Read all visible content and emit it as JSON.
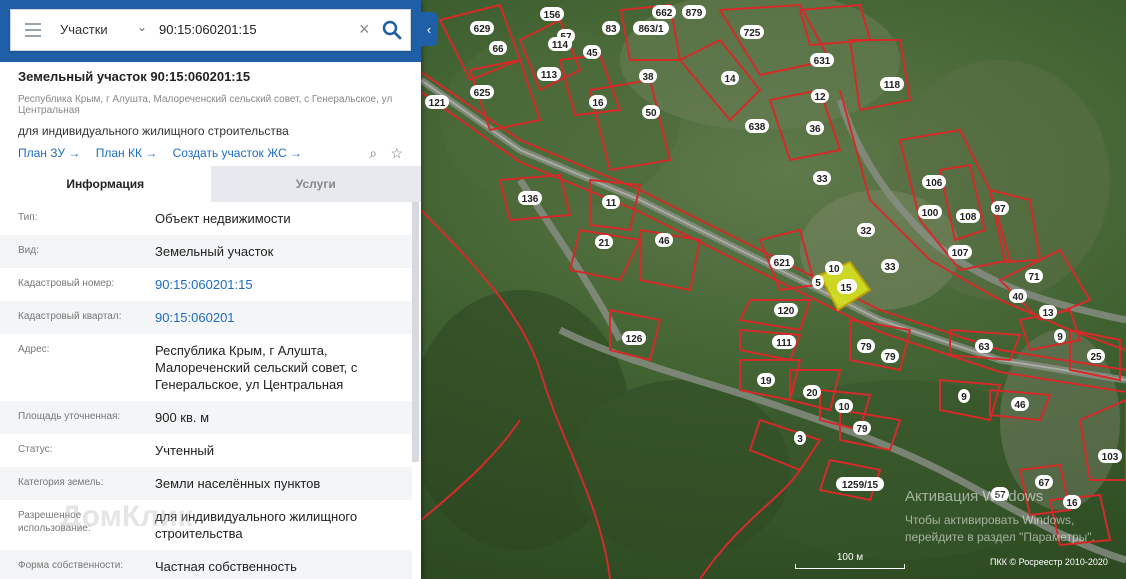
{
  "search": {
    "type_label": "Участки",
    "value": "90:15:060201:15"
  },
  "header": {
    "title": "Земельный участок 90:15:060201:15",
    "address": "Республика Крым, г Алушта, Малореченский сельский совет, с Генеральское, ул Центральная",
    "purpose": "для индивидуального жилищного строительства",
    "links": [
      "План ЗУ →",
      "План КК →",
      "Создать участок ЖС →"
    ]
  },
  "tabs": [
    "Информация",
    "Услуги"
  ],
  "info": [
    {
      "k": "Тип:",
      "v": "Объект недвижимости"
    },
    {
      "k": "Вид:",
      "v": "Земельный участок"
    },
    {
      "k": "Кадастровый номер:",
      "v": "90:15:060201:15"
    },
    {
      "k": "Кадастровый квартал:",
      "v": "90:15:060201"
    },
    {
      "k": "Адрес:",
      "v": "Республика Крым, г Алушта, Малореченский сельский совет, с Генеральское, ул Центральная"
    },
    {
      "k": "Площадь уточненная:",
      "v": "900 кв. м"
    },
    {
      "k": "Статус:",
      "v": "Учтенный"
    },
    {
      "k": "Категория земель:",
      "v": "Земли населённых пунктов"
    },
    {
      "k": "Разрешенное использование:",
      "v": "для индивидуального жилищного строительства"
    },
    {
      "k": "Форма собственности:",
      "v": "Частная собственность"
    }
  ],
  "watermark": "ДомКлик",
  "map": {
    "lot_labels": [
      "629",
      "66",
      "156",
      "879",
      "83",
      "57",
      "863/1",
      "662",
      "114",
      "45",
      "725",
      "631",
      "113",
      "38",
      "14",
      "118",
      "121",
      "625",
      "16",
      "12",
      "638",
      "36",
      "50",
      "33",
      "136",
      "11",
      "106",
      "100",
      "108",
      "97",
      "21",
      "46",
      "32",
      "107",
      "621",
      "10",
      "5",
      "15",
      "33",
      "71",
      "40",
      "120",
      "13",
      "126",
      "111",
      "79",
      "79",
      "63",
      "9",
      "25",
      "19",
      "20",
      "10",
      "9",
      "46",
      "3",
      "79",
      "1259/15",
      "103",
      "67",
      "16",
      "57"
    ],
    "selected_lot": "15"
  },
  "windows": {
    "line1": "Активация Windows",
    "line2": "Чтобы активировать Windows, перейдите в раздел \"Параметры\"."
  },
  "scale_label": "100 м",
  "copyright": "ПКК © Росреестр 2010-2020"
}
